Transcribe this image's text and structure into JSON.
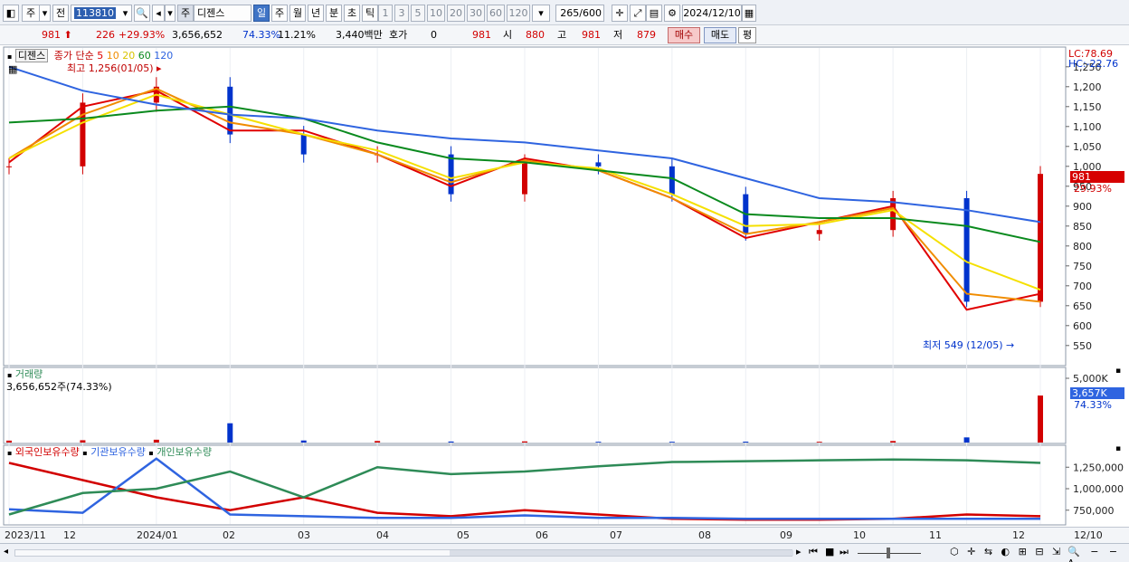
{
  "toolbar": {
    "market_label": "주",
    "prev_label": "전",
    "stock_code": "113810",
    "type_badge": "주",
    "stock_name": "디젠스",
    "periods": [
      "일",
      "주",
      "월",
      "년",
      "분",
      "초",
      "틱"
    ],
    "active_period": "일",
    "intervals": [
      "1",
      "3",
      "5",
      "10",
      "20",
      "30",
      "60",
      "120"
    ],
    "count_display": "265",
    "count_max": "/600",
    "date": "2024/12/10"
  },
  "quote": {
    "price": "981",
    "change": "226",
    "change_pct": "+29.93%",
    "volume": "3,656,652",
    "volume_ratio": "74.33%",
    "turnover": "11.21%",
    "amount": "3,440백만",
    "hoga_label": "호가",
    "hoga_value": "0",
    "hoga_price": "981",
    "open_label": "시",
    "open_value": "880",
    "high_label": "고",
    "high_value": "981",
    "low_label": "저",
    "low_value": "879",
    "buy_label": "매수",
    "sell_label": "매도",
    "eval_label": "평"
  },
  "price_panel": {
    "stock_name": "디젠스",
    "legend_prefix": "종가 단순",
    "ma_labels": [
      "5",
      "10",
      "20",
      "60",
      "120"
    ],
    "high_annotation": "최고 1,256(01/05)",
    "low_annotation": "최저 549 (12/05)",
    "lc_label": "LC:78.69",
    "hc_label": "HC:-22.76",
    "current_price": "981",
    "current_pct": "29.93%"
  },
  "volume_panel": {
    "title": "거래량",
    "info": "3,656,652주(74.33%)",
    "current_value": "3,657K",
    "current_pct": "74.33%"
  },
  "holding_panel": {
    "series_labels": [
      "외국인보유수량",
      "기관보유수량",
      "개인보유수량"
    ]
  },
  "x_axis_labels": [
    "2023/11",
    "12",
    "2024/01",
    "02",
    "03",
    "04",
    "05",
    "06",
    "07",
    "08",
    "09",
    "10",
    "11",
    "12",
    "12/10"
  ],
  "colors": {
    "up": "#d20000",
    "down": "#0033cc",
    "ma5": "#e00000",
    "ma10": "#f08c00",
    "ma20": "#f5e000",
    "ma60": "#0a8a1e",
    "ma120": "#2f64e0",
    "foreign": "#d20000",
    "institution": "#2f64e0",
    "individual": "#2e8b57"
  },
  "chart_data": [
    {
      "type": "line",
      "title": "",
      "ylabel": "",
      "ylim": [
        520,
        1270
      ],
      "yticks": [
        550,
        600,
        650,
        700,
        750,
        800,
        850,
        900,
        950,
        1000,
        1050,
        1100,
        1150,
        1200,
        1250
      ],
      "x": [
        "2023/11",
        "12",
        "2024/01",
        "02",
        "03",
        "04",
        "05",
        "06",
        "07",
        "08",
        "09",
        "10",
        "11",
        "12",
        "12/10"
      ],
      "series": [
        {
          "name": "종가",
          "values": [
            1000,
            1160,
            1200,
            1080,
            1030,
            1030,
            930,
            1010,
            1000,
            930,
            830,
            840,
            920,
            660,
            981
          ]
        },
        {
          "name": "5",
          "values": [
            1010,
            1150,
            1190,
            1090,
            1090,
            1030,
            950,
            1020,
            990,
            920,
            820,
            860,
            900,
            640,
            680
          ]
        },
        {
          "name": "10",
          "values": [
            1020,
            1130,
            1195,
            1110,
            1080,
            1030,
            960,
            1015,
            990,
            920,
            830,
            860,
            895,
            680,
            660
          ]
        },
        {
          "name": "20",
          "values": [
            1020,
            1110,
            1180,
            1130,
            1080,
            1040,
            970,
            1010,
            995,
            930,
            850,
            855,
            890,
            760,
            690
          ]
        },
        {
          "name": "60",
          "values": [
            1110,
            1120,
            1140,
            1150,
            1120,
            1060,
            1020,
            1010,
            990,
            970,
            880,
            870,
            870,
            850,
            810
          ]
        },
        {
          "name": "120",
          "values": [
            1250,
            1190,
            1155,
            1130,
            1120,
            1090,
            1070,
            1060,
            1040,
            1020,
            970,
            920,
            910,
            890,
            860
          ]
        }
      ]
    },
    {
      "type": "bar",
      "title": "거래량",
      "ylim": [
        0,
        5000
      ],
      "yticks_labels": [
        "5,000K"
      ],
      "categories": [
        "2023/11",
        "12",
        "2024/01",
        "02",
        "03",
        "04",
        "05",
        "06",
        "07",
        "08",
        "09",
        "10",
        "11",
        "12",
        "12/10"
      ],
      "values": [
        150,
        180,
        220,
        1500,
        160,
        120,
        80,
        90,
        60,
        60,
        70,
        60,
        120,
        400,
        3657
      ]
    },
    {
      "type": "line",
      "title": "",
      "ylim": [
        600000,
        1400000
      ],
      "yticks": [
        750000,
        1000000,
        1250000
      ],
      "x": [
        "2023/11",
        "12",
        "2024/01",
        "02",
        "03",
        "04",
        "05",
        "06",
        "07",
        "08",
        "09",
        "10",
        "11",
        "12",
        "12/10"
      ],
      "series": [
        {
          "name": "외국인보유수량",
          "values": [
            1300000,
            1100000,
            900000,
            750000,
            900000,
            720000,
            680000,
            750000,
            700000,
            650000,
            640000,
            640000,
            650000,
            700000,
            680000
          ]
        },
        {
          "name": "기관보유수량",
          "values": [
            760000,
            720000,
            1350000,
            700000,
            680000,
            660000,
            660000,
            690000,
            660000,
            660000,
            650000,
            650000,
            650000,
            650000,
            650000
          ]
        },
        {
          "name": "개인보유수량",
          "values": [
            700000,
            950000,
            1000000,
            1200000,
            900000,
            1250000,
            1170000,
            1200000,
            1260000,
            1310000,
            1320000,
            1330000,
            1340000,
            1330000,
            1300000
          ]
        }
      ]
    }
  ]
}
